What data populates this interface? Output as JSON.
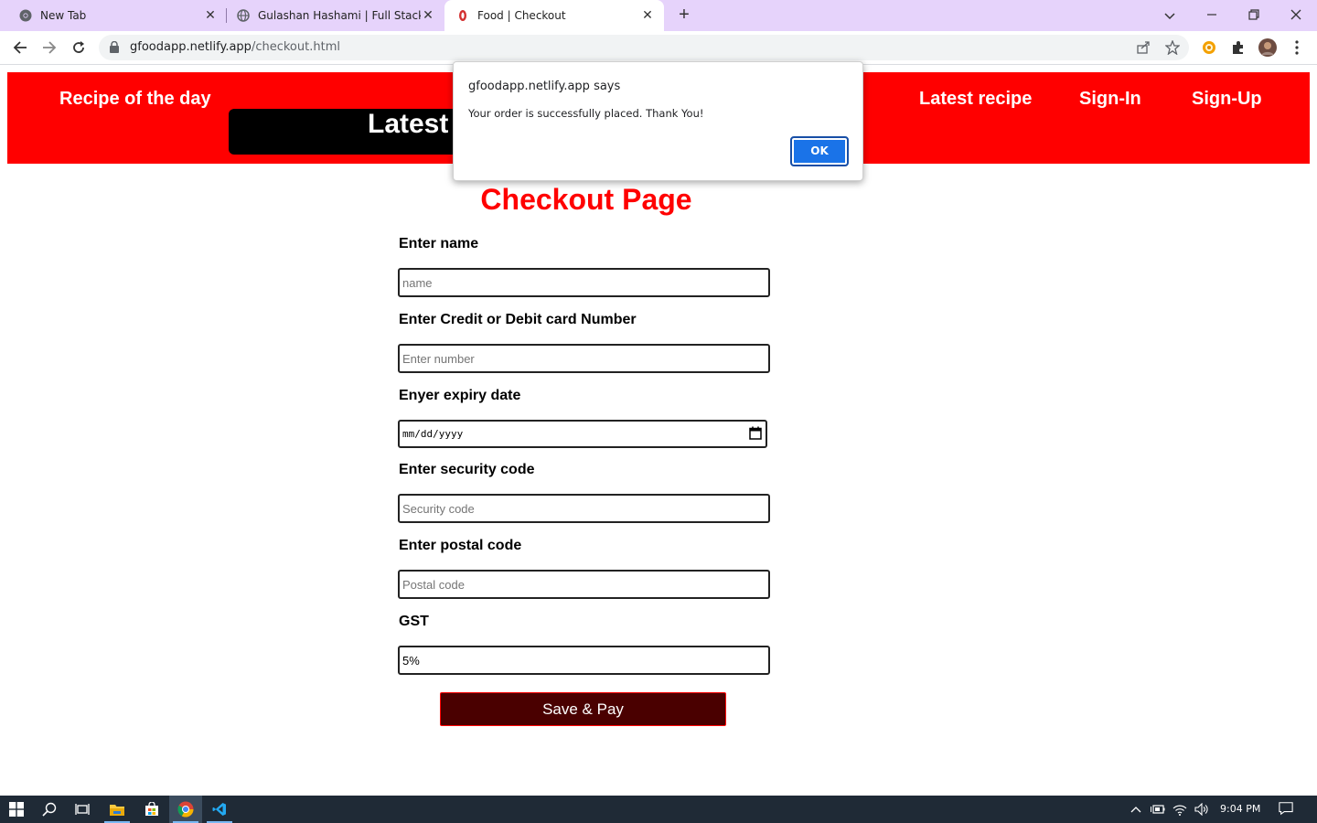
{
  "browser": {
    "tabs": [
      {
        "title": "New Tab",
        "active": false
      },
      {
        "title": "Gulashan Hashami | Full Stack We",
        "active": false
      },
      {
        "title": "Food | Checkout",
        "active": true
      }
    ],
    "url_host": "gfoodapp.netlify.app",
    "url_path": "/checkout.html"
  },
  "header": {
    "recipe_of_day": "Recipe of the day",
    "latest_box": "Latest",
    "latest_recipe": "Latest recipe",
    "sign_in": "Sign-In",
    "sign_up": "Sign-Up",
    "color": "#ff0000"
  },
  "form": {
    "title": "Checkout Page",
    "name_label": "Enter name",
    "name_placeholder": "name",
    "card_label": "Enter Credit or Debit card Number",
    "card_placeholder": "Enter number",
    "expiry_label": "Enyer expiry date",
    "expiry_placeholder": "mm/dd/yyyy",
    "security_label": "Enter security code",
    "security_placeholder": "Security code",
    "postal_label": "Enter postal code",
    "postal_placeholder": "Postal code",
    "gst_label": "GST",
    "gst_value": "5%",
    "pay_button": "Save & Pay"
  },
  "dialog": {
    "origin": "gfoodapp.netlify.app says",
    "message": "Your order is successfully placed. Thank You!",
    "ok": "OK"
  },
  "taskbar": {
    "time": "9:04 PM"
  }
}
